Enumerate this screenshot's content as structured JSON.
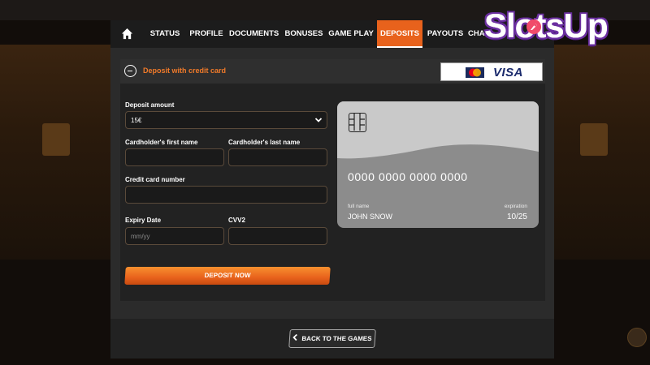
{
  "nav": {
    "items": [
      "STATUS",
      "PROFILE",
      "DOCUMENTS",
      "BONUSES",
      "GAME PLAY",
      "DEPOSITS",
      "PAYOUTS",
      "CHA"
    ],
    "active": "DEPOSITS"
  },
  "panel": {
    "title": "Deposit with credit card",
    "visa": "VISA"
  },
  "form": {
    "deposit_amount_label": "Deposit amount",
    "deposit_amount_value": "15€",
    "first_name_label": "Cardholder's first name",
    "first_name_value": "",
    "last_name_label": "Cardholder's last name",
    "last_name_value": "",
    "card_number_label": "Credit card number",
    "card_number_value": "",
    "expiry_label": "Expiry Date",
    "expiry_placeholder": "mm/yy",
    "cvv_label": "CVV2",
    "cvv_value": "",
    "submit_label": "DEPOSIT NOW"
  },
  "card_preview": {
    "number": "0000 0000 0000 0000",
    "full_name_label": "full name",
    "full_name": "JOHN SNOW",
    "expiration_label": "expiration",
    "expiration": "10/25"
  },
  "footer": {
    "back_label": "BACK TO THE GAMES"
  },
  "brand": {
    "name": "SlotsUp"
  },
  "colors": {
    "accent": "#e8621c",
    "title_accent": "#f07a2a",
    "modal_bg": "#2b2b2b",
    "brand_outline": "#6b2fa0"
  }
}
